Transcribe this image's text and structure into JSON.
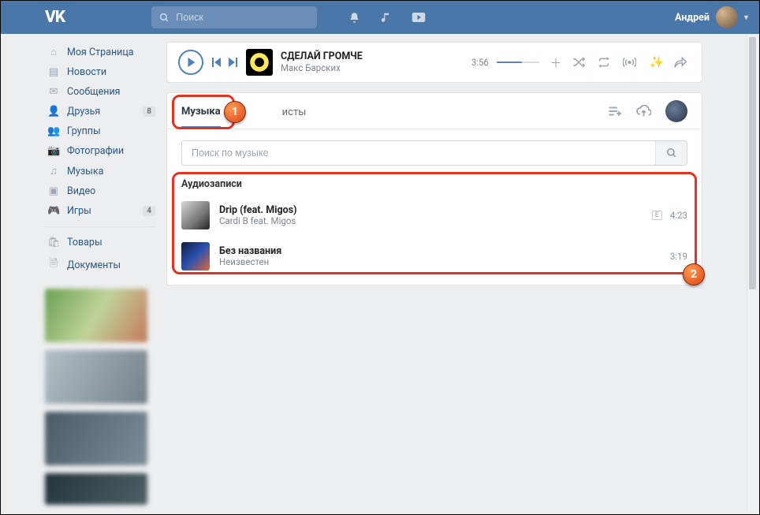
{
  "header": {
    "logo": "VK",
    "search_placeholder": "Поиск",
    "user_name": "Андрей"
  },
  "sidebar": {
    "items": [
      {
        "icon": "home",
        "label": "Моя Страница"
      },
      {
        "icon": "news",
        "label": "Новости"
      },
      {
        "icon": "msg",
        "label": "Сообщения"
      },
      {
        "icon": "friends",
        "label": "Друзья",
        "badge": "8"
      },
      {
        "icon": "groups",
        "label": "Группы"
      },
      {
        "icon": "photo",
        "label": "Фотографии"
      },
      {
        "icon": "music",
        "label": "Музыка"
      },
      {
        "icon": "video",
        "label": "Видео"
      },
      {
        "icon": "games",
        "label": "Игры",
        "badge": "4"
      }
    ],
    "items2": [
      {
        "icon": "market",
        "label": "Товары"
      },
      {
        "icon": "docs",
        "label": "Документы"
      }
    ]
  },
  "player": {
    "title": "СДЕЛАЙ ГРОМЧЕ",
    "artist": "Макс Барских",
    "time": "3:56"
  },
  "tabs": {
    "music": "Музыка",
    "playlists_suffix": "исты"
  },
  "search": {
    "placeholder": "Поиск по музыке"
  },
  "section_title": "Аудиозаписи",
  "tracks": [
    {
      "cover": "a",
      "title": "Drip (feat. Migos)",
      "artist": "Cardi B feat. Migos",
      "explicit": true,
      "duration": "4:23"
    },
    {
      "cover": "b",
      "title": "Без названия",
      "artist": "Неизвестен",
      "explicit": false,
      "duration": "3:19"
    }
  ],
  "callouts": {
    "one": "1",
    "two": "2"
  }
}
